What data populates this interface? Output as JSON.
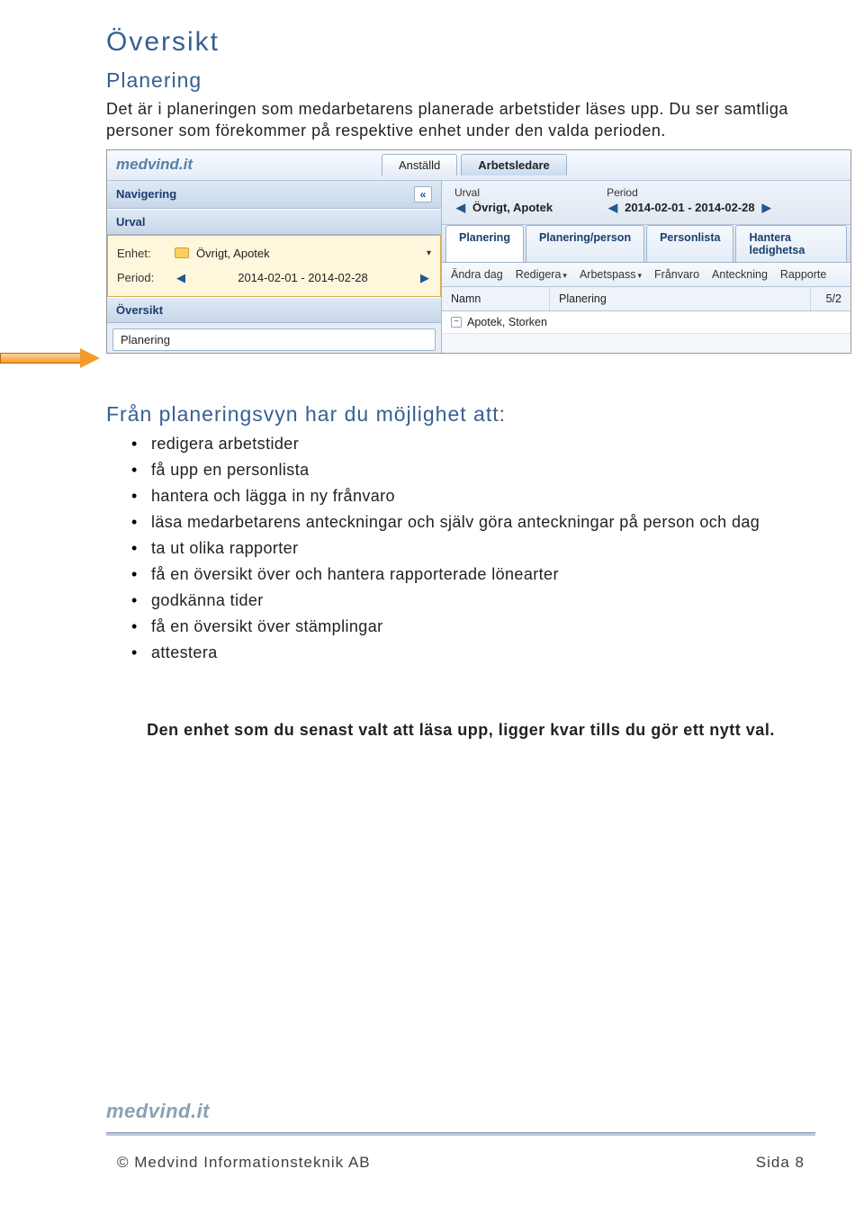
{
  "heading": "Översikt",
  "section_title": "Planering",
  "intro": "Det är i planeringen som medarbetarens planerade arbetstider läses upp. Du ser samtliga personer som förekommer på respektive enhet under den valda perioden.",
  "screenshot": {
    "logo": "medvind.it",
    "top_tabs": {
      "tab1": "Anställd",
      "tab2": "Arbetsledare"
    },
    "sidebar": {
      "nav_title": "Navigering",
      "urval_title": "Urval",
      "enhet_label": "Enhet:",
      "enhet_value": "Övrigt, Apotek",
      "period_label": "Period:",
      "period_value": "2014-02-01 - 2014-02-28",
      "oversikt_title": "Översikt",
      "item_planering": "Planering"
    },
    "main": {
      "urval_label": "Urval",
      "urval_value": "Övrigt, Apotek",
      "period_label": "Period",
      "period_value": "2014-02-01 - 2014-02-28",
      "tabs": {
        "t1": "Planering",
        "t2": "Planering/person",
        "t3": "Personlista",
        "t4": "Hantera ledighetsa"
      },
      "toolbar": {
        "b1": "Ändra dag",
        "b2": "Redigera",
        "b3": "Arbetspass",
        "b4": "Frånvaro",
        "b5": "Anteckning",
        "b6": "Rapporte"
      },
      "grid": {
        "col1": "Namn",
        "col2": "Planering",
        "col3": "5/2",
        "row1": "Apotek, Storken"
      }
    }
  },
  "list_heading": "Från planeringsvyn har du möjlighet att:",
  "bullets": {
    "b1": "redigera arbetstider",
    "b2": "få upp en personlista",
    "b3": "hantera och lägga in ny frånvaro",
    "b4": "läsa medarbetarens anteckningar och själv göra anteckningar på person och dag",
    "b5": "ta ut olika rapporter",
    "b6": "få en översikt över och hantera rapporterade lönearter",
    "b7": "godkänna tider",
    "b8": "få en översikt över stämplingar",
    "b9": "attestera"
  },
  "note": "Den enhet som du senast valt att läsa upp, ligger kvar tills du gör ett nytt val.",
  "footer": {
    "logo": "medvind.it",
    "copyright": "© Medvind Informationsteknik AB",
    "page": "Sida 8"
  }
}
